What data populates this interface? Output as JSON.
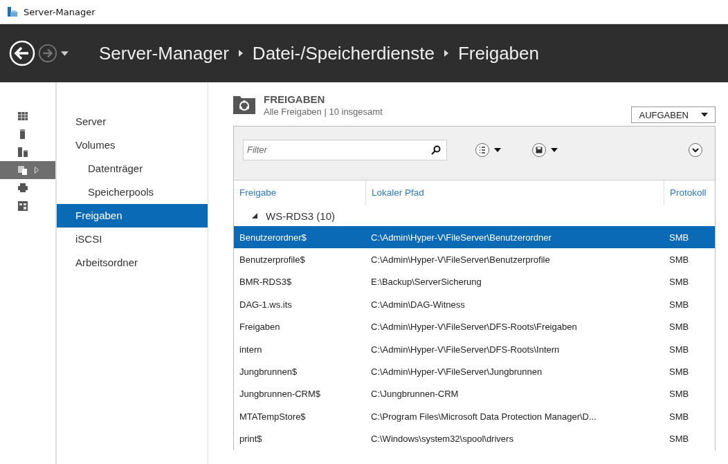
{
  "window": {
    "title": "Server-Manager"
  },
  "breadcrumb": [
    "Server-Manager",
    "Datei-/Speicherdienste",
    "Freigaben"
  ],
  "navigation": {
    "back_disabled": false,
    "forward_disabled": true
  },
  "icon_rail": [
    {
      "kind": "dashboard",
      "selected": false
    },
    {
      "kind": "server",
      "selected": false
    },
    {
      "kind": "servers",
      "selected": false
    },
    {
      "kind": "files",
      "selected": true
    },
    {
      "kind": "printer",
      "selected": false
    },
    {
      "kind": "roles",
      "selected": false
    }
  ],
  "sidebar": {
    "items": [
      {
        "label": "Server",
        "selected": false
      },
      {
        "label": "Volumes",
        "selected": false,
        "children": [
          {
            "label": "Datenträger",
            "selected": false
          },
          {
            "label": "Speicherpools",
            "selected": false
          }
        ]
      },
      {
        "label": "Freigaben",
        "selected": true
      },
      {
        "label": "iSCSI",
        "selected": false
      },
      {
        "label": "Arbeitsordner",
        "selected": false
      }
    ]
  },
  "section": {
    "title": "FREIGABEN",
    "subtitle": "Alle Freigaben | 10 insgesamt",
    "tasks_button": "AUFGABEN"
  },
  "filter": {
    "placeholder": "Filter"
  },
  "table": {
    "columns": [
      "Freigabe",
      "Lokaler Pfad",
      "Protokoll"
    ],
    "group": {
      "label": "WS-RDS3 (10)",
      "expanded": true
    },
    "rows": [
      {
        "cells": [
          "Benutzerordner$",
          "C:\\Admin\\Hyper-V\\FileServer\\Benutzerordner",
          "SMB"
        ],
        "selected": true
      },
      {
        "cells": [
          "Benutzerprofile$",
          "C:\\Admin\\Hyper-V\\FileServer\\Benutzerprofile",
          "SMB"
        ],
        "selected": false
      },
      {
        "cells": [
          "BMR-RDS3$",
          "E:\\Backup\\ServerSicherung",
          "SMB"
        ],
        "selected": false
      },
      {
        "cells": [
          "DAG-1.ws.its",
          "C:\\Admin\\DAG-Witness",
          "SMB"
        ],
        "selected": false
      },
      {
        "cells": [
          "Freigaben",
          "C:\\Admin\\Hyper-V\\FileServer\\DFS-Roots\\Freigaben",
          "SMB"
        ],
        "selected": false
      },
      {
        "cells": [
          "intern",
          "C:\\Admin\\Hyper-V\\FileServer\\DFS-Roots\\Intern",
          "SMB"
        ],
        "selected": false
      },
      {
        "cells": [
          "Jungbrunnen$",
          "C:\\Admin\\Hyper-V\\FileServer\\Jungbrunnen",
          "SMB"
        ],
        "selected": false
      },
      {
        "cells": [
          "Jungbrunnen-CRM$",
          "C:\\Jungbrunnen-CRM",
          "SMB"
        ],
        "selected": false
      },
      {
        "cells": [
          "MTATempStore$",
          "C:\\Program Files\\Microsoft Data Protection Manager\\D...",
          "SMB"
        ],
        "selected": false
      },
      {
        "cells": [
          "print$",
          "C:\\Windows\\system32\\spool\\drivers",
          "SMB"
        ],
        "selected": false
      }
    ]
  }
}
